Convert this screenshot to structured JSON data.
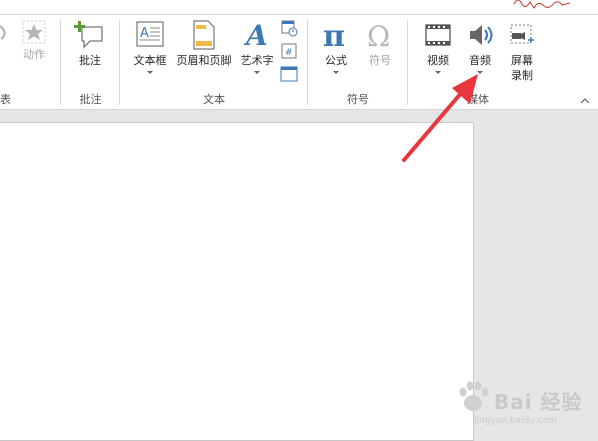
{
  "ribbon": {
    "groups": {
      "cut_left": {
        "label": "表"
      },
      "comments": {
        "label": "批注"
      },
      "text": {
        "label": "文本"
      },
      "symbols": {
        "label": "符号"
      },
      "media": {
        "label": "媒体"
      }
    },
    "buttons": {
      "action": {
        "label": "动作",
        "enabled": false
      },
      "comment": {
        "label": "批注"
      },
      "textbox": {
        "label": "文本框",
        "has_dropdown": true
      },
      "header_footer": {
        "label": "页眉和页脚"
      },
      "wordart": {
        "label": "艺术字",
        "has_dropdown": true
      },
      "equation": {
        "label": "公式",
        "has_dropdown": true
      },
      "symbol": {
        "label": "符号",
        "enabled": false
      },
      "video": {
        "label": "视频",
        "has_dropdown": true
      },
      "audio": {
        "label": "音频",
        "has_dropdown": true
      },
      "screen_recording": {
        "label_line1": "屏幕",
        "label_line2": "录制"
      }
    }
  },
  "watermark": {
    "text": "Bai 经验",
    "url": "jingyan.baidu.com"
  },
  "colors": {
    "accent_blue": "#3c78b4",
    "arrow_red": "#e8363c",
    "disabled_gray": "#a6a6a6",
    "comment_green": "#5b9a3c"
  }
}
